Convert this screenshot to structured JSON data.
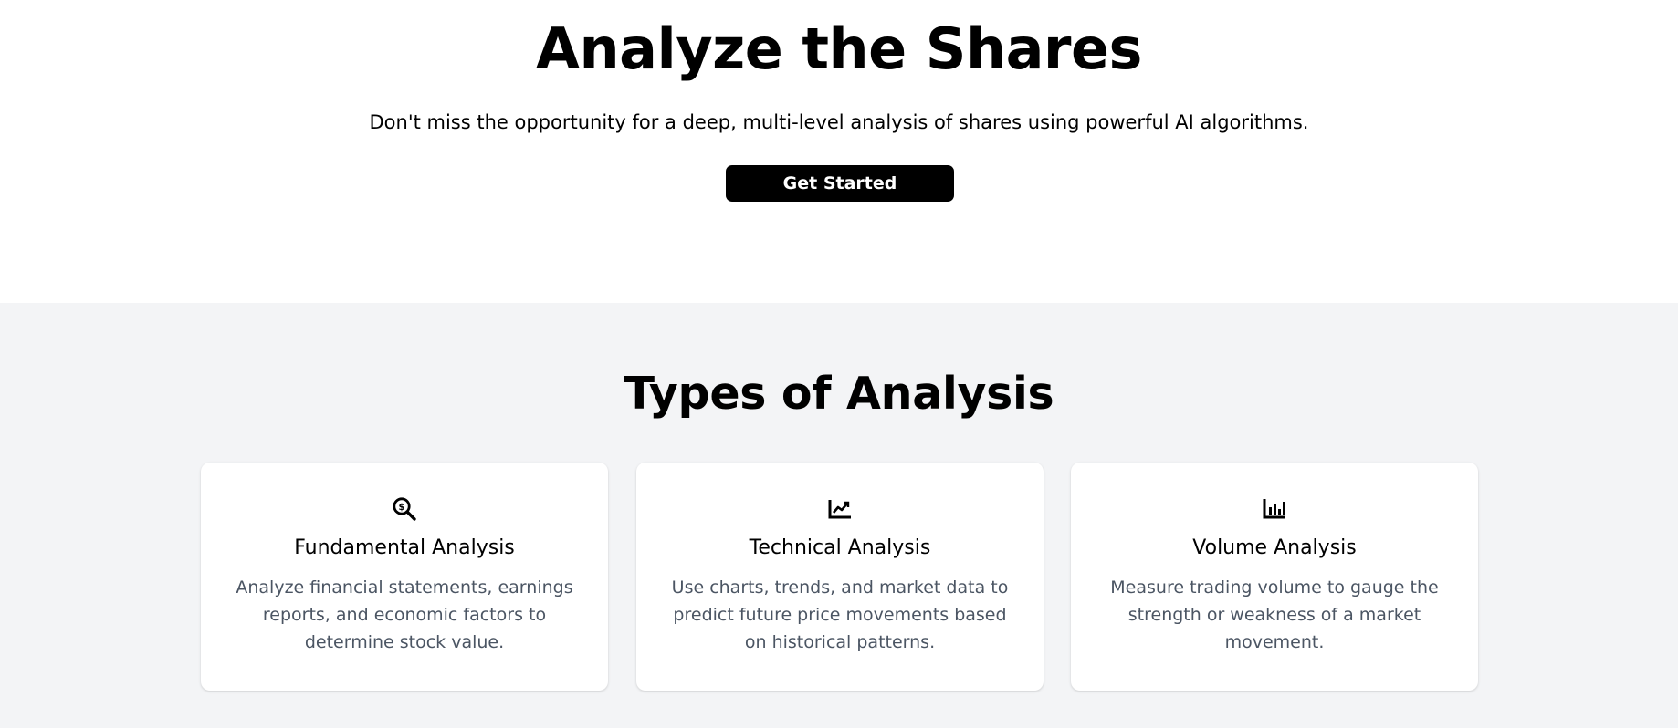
{
  "hero": {
    "title": "Analyze the Shares",
    "subtitle": "Don't miss the opportunity for a deep, multi-level analysis of shares using powerful AI algorithms.",
    "cta_label": "Get Started"
  },
  "types_section": {
    "title": "Types of Analysis",
    "cards": [
      {
        "icon": "magnifier-dollar-icon",
        "title": "Fundamental Analysis",
        "description": "Analyze financial statements, earnings reports, and economic factors to determine stock value."
      },
      {
        "icon": "chart-line-icon",
        "title": "Technical Analysis",
        "description": "Use charts, trends, and market data to predict future price movements based on historical patterns."
      },
      {
        "icon": "bar-chart-icon",
        "title": "Volume Analysis",
        "description": "Measure trading volume to gauge the strength or weakness of a market movement."
      }
    ]
  },
  "colors": {
    "page_background": "#ffffff",
    "section_background": "#f3f4f6",
    "button_background": "#000000",
    "button_text": "#ffffff",
    "description_text": "#4b5563"
  }
}
